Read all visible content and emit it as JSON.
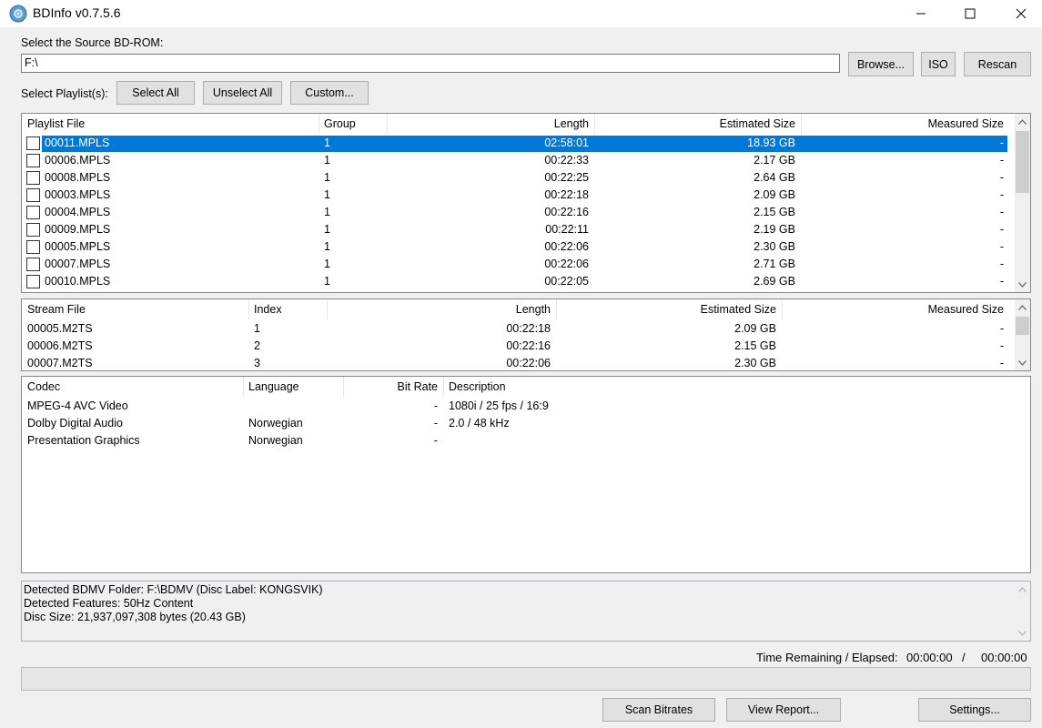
{
  "window": {
    "title": "BDInfo v0.7.5.6",
    "icon": "disc-icon"
  },
  "source": {
    "label": "Select the Source BD-ROM:",
    "path": "F:\\",
    "browse_label": "Browse...",
    "iso_label": "ISO",
    "rescan_label": "Rescan"
  },
  "playlist_select": {
    "label": "Select Playlist(s):",
    "select_all": "Select All",
    "unselect_all": "Unselect All",
    "custom": "Custom..."
  },
  "playlists": {
    "columns": [
      "Playlist File",
      "Group",
      "Length",
      "Estimated Size",
      "Measured Size"
    ],
    "rows": [
      {
        "file": "00011.MPLS",
        "group": "1",
        "length": "02:58:01",
        "est": "18.93 GB",
        "meas": "-",
        "selected": true
      },
      {
        "file": "00006.MPLS",
        "group": "1",
        "length": "00:22:33",
        "est": "2.17 GB",
        "meas": "-"
      },
      {
        "file": "00008.MPLS",
        "group": "1",
        "length": "00:22:25",
        "est": "2.64 GB",
        "meas": "-"
      },
      {
        "file": "00003.MPLS",
        "group": "1",
        "length": "00:22:18",
        "est": "2.09 GB",
        "meas": "-"
      },
      {
        "file": "00004.MPLS",
        "group": "1",
        "length": "00:22:16",
        "est": "2.15 GB",
        "meas": "-"
      },
      {
        "file": "00009.MPLS",
        "group": "1",
        "length": "00:22:11",
        "est": "2.19 GB",
        "meas": "-"
      },
      {
        "file": "00005.MPLS",
        "group": "1",
        "length": "00:22:06",
        "est": "2.30 GB",
        "meas": "-"
      },
      {
        "file": "00007.MPLS",
        "group": "1",
        "length": "00:22:06",
        "est": "2.71 GB",
        "meas": "-"
      },
      {
        "file": "00010.MPLS",
        "group": "1",
        "length": "00:22:05",
        "est": "2.69 GB",
        "meas": "-"
      }
    ]
  },
  "streams": {
    "columns": [
      "Stream File",
      "Index",
      "Length",
      "Estimated Size",
      "Measured Size"
    ],
    "rows": [
      {
        "file": "00005.M2TS",
        "index": "1",
        "length": "00:22:18",
        "est": "2.09 GB",
        "meas": "-"
      },
      {
        "file": "00006.M2TS",
        "index": "2",
        "length": "00:22:16",
        "est": "2.15 GB",
        "meas": "-"
      },
      {
        "file": "00007.M2TS",
        "index": "3",
        "length": "00:22:06",
        "est": "2.30 GB",
        "meas": "-"
      }
    ]
  },
  "codecs": {
    "columns": [
      "Codec",
      "Language",
      "Bit Rate",
      "Description"
    ],
    "rows": [
      {
        "codec": "MPEG-4 AVC Video",
        "language": "",
        "bitrate": "-",
        "desc": "1080i / 25 fps / 16:9"
      },
      {
        "codec": "Dolby Digital Audio",
        "language": "Norwegian",
        "bitrate": "-",
        "desc": "2.0 / 48 kHz"
      },
      {
        "codec": "Presentation Graphics",
        "language": "Norwegian",
        "bitrate": "-",
        "desc": ""
      }
    ]
  },
  "log": {
    "lines": [
      "Detected BDMV Folder: F:\\BDMV (Disc Label: KONGSVIK)",
      "Detected Features: 50Hz Content",
      "Disc Size: 21,937,097,308 bytes (20.43 GB)"
    ]
  },
  "status": {
    "time_label": "Time Remaining / Elapsed:",
    "remaining": "00:00:00",
    "separator": "/",
    "elapsed": "00:00:00",
    "progress": 0
  },
  "actions": {
    "scan_bitrates": "Scan Bitrates",
    "view_report": "View Report...",
    "settings": "Settings..."
  },
  "colors": {
    "selection": "#0078d7",
    "window_bg": "#f0f0f0"
  }
}
